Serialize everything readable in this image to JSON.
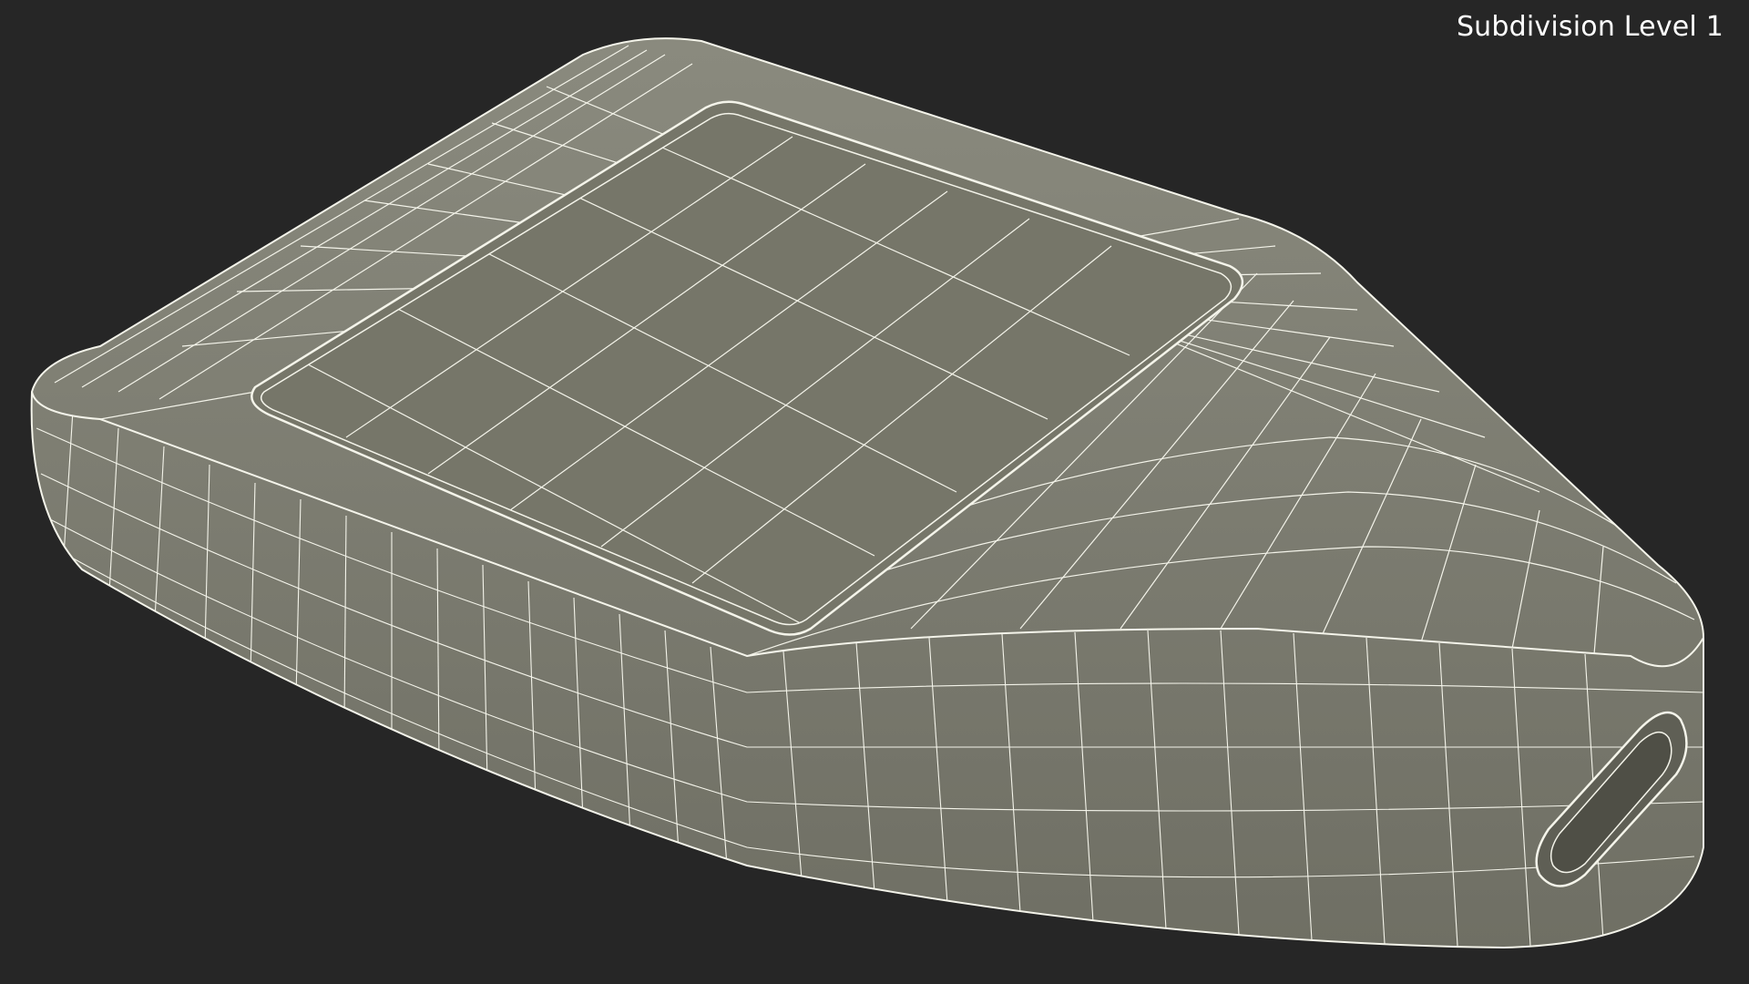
{
  "viewport": {
    "label": "Subdivision Level 1",
    "background_color": "#262626",
    "label_color": "#ffffff",
    "model_fill_color": "#7c7c70",
    "wire_color": "#f4f4ea",
    "subject": "wireframe-model"
  }
}
